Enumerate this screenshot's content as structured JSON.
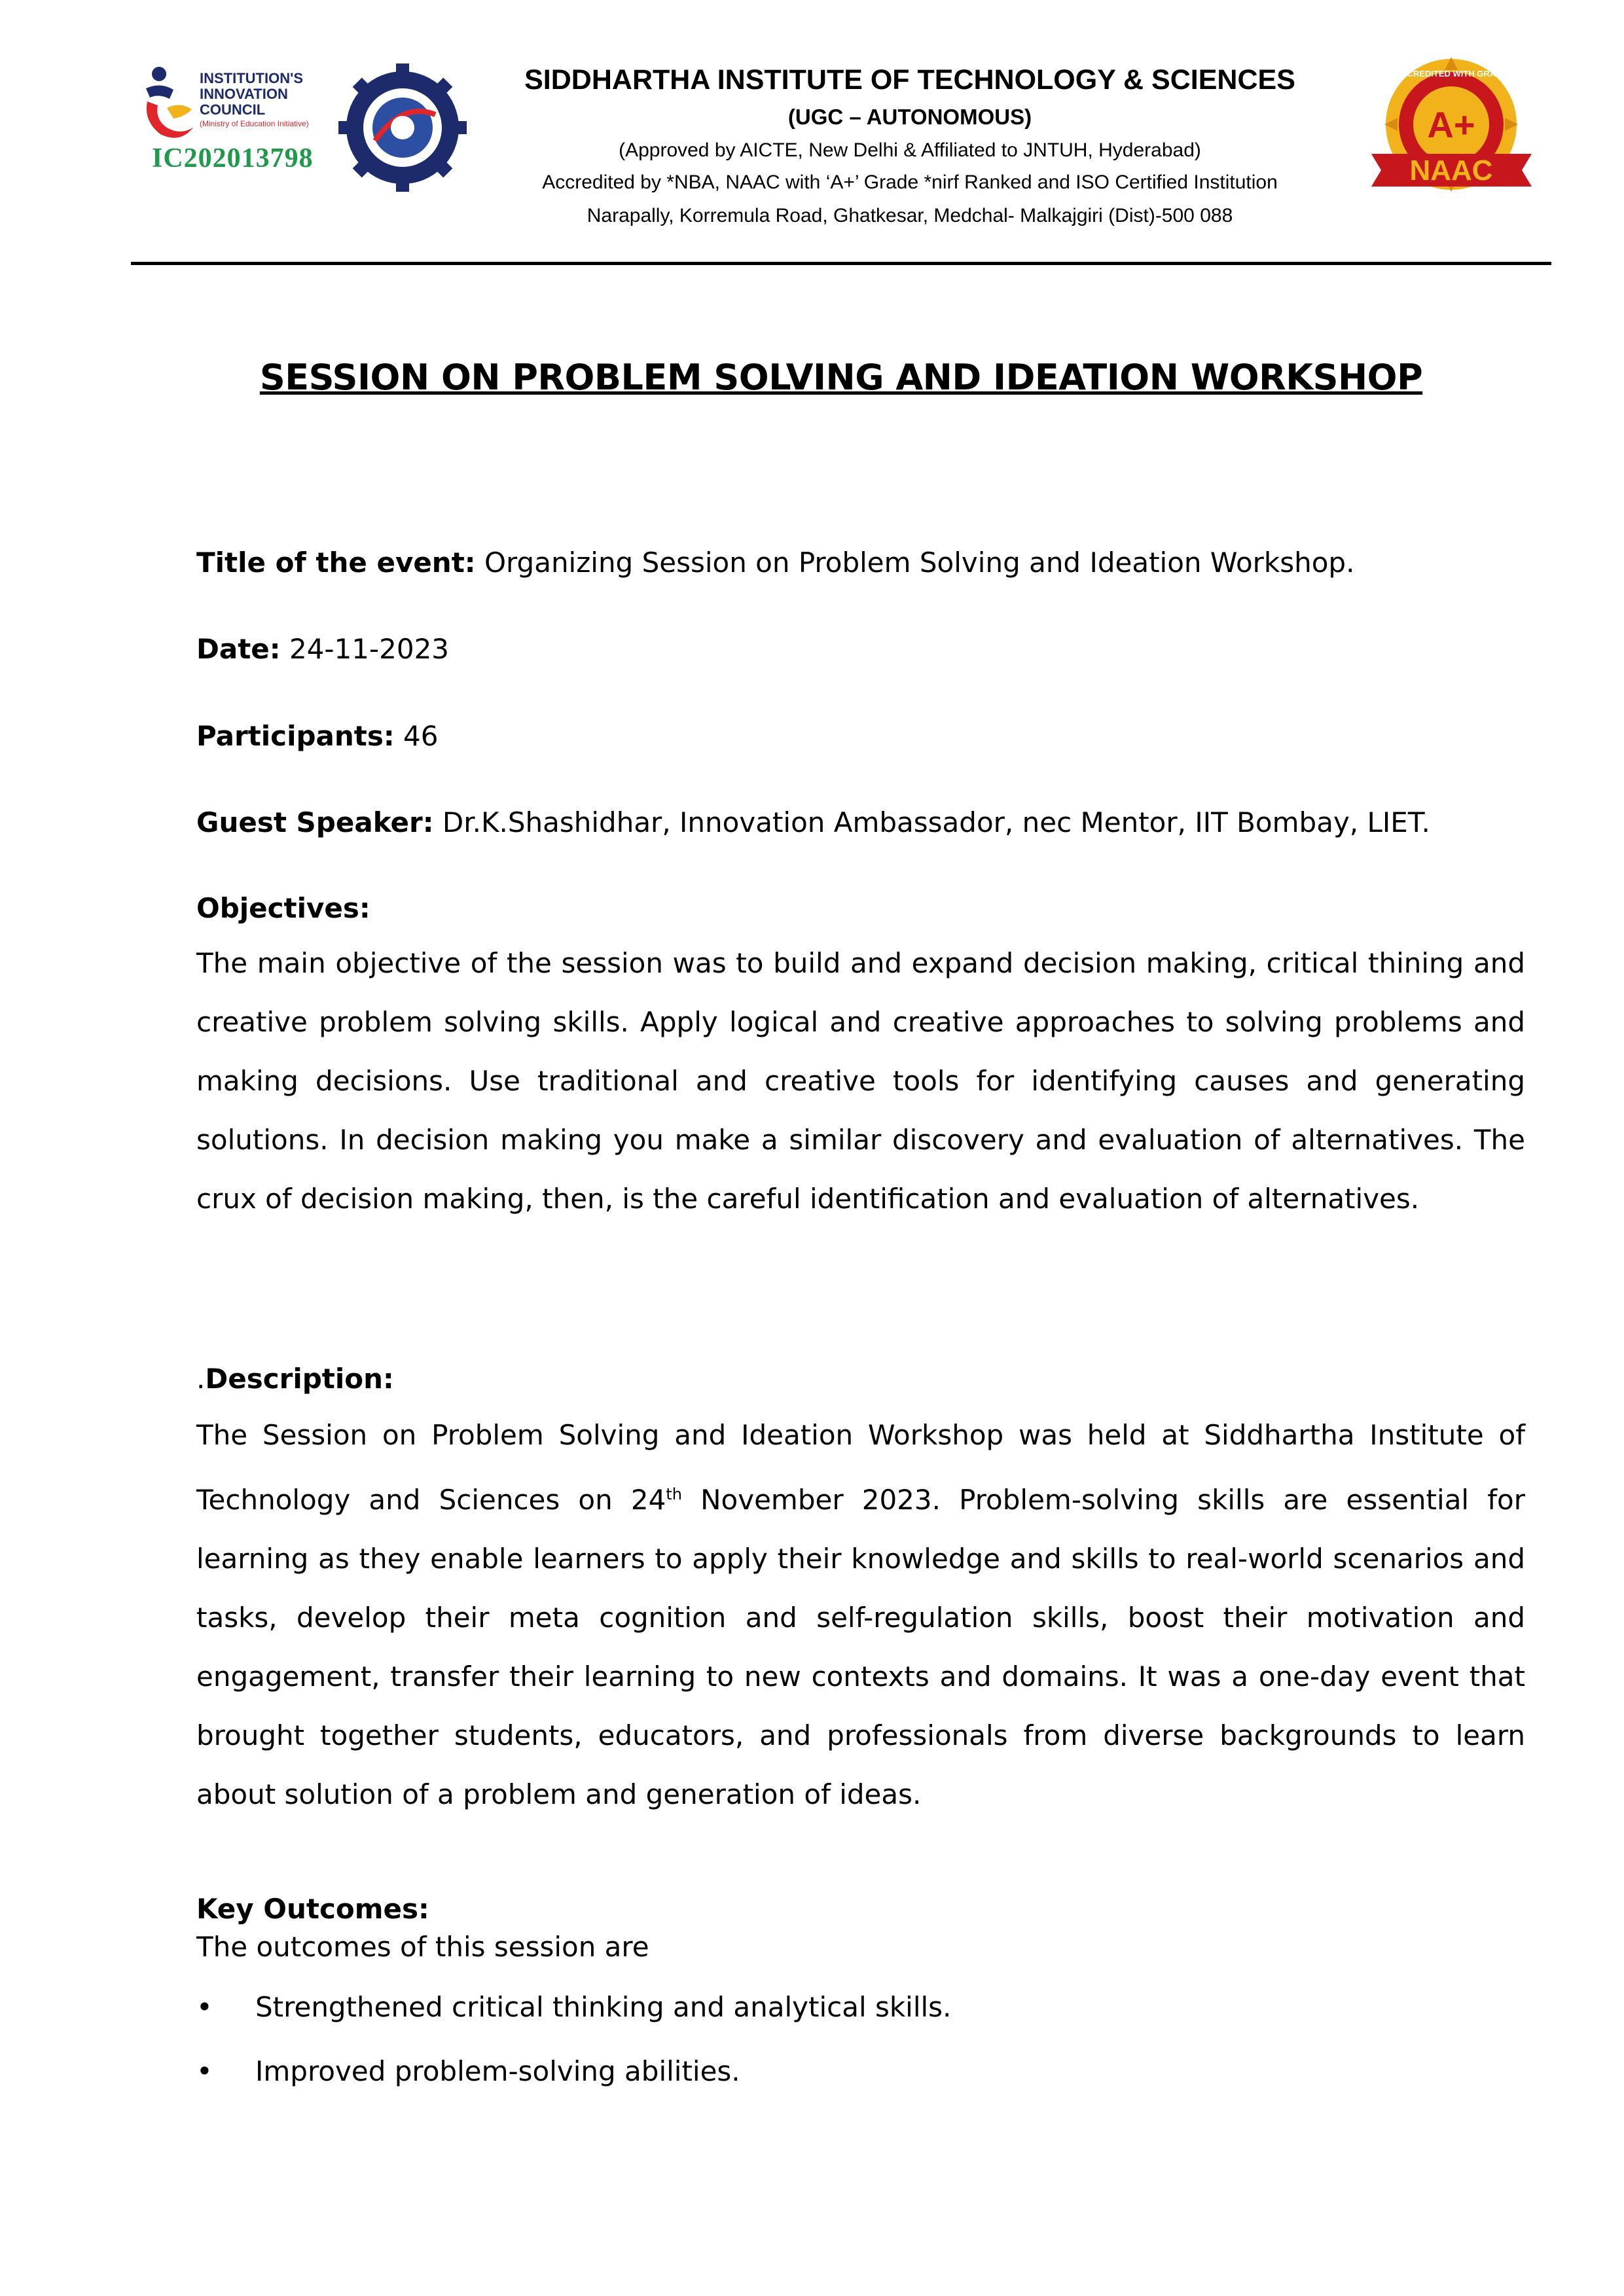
{
  "header": {
    "iic_logo_text": [
      "INSTITUTION'S",
      "INNOVATION",
      "COUNCIL",
      "(Ministry of Education Initiative)"
    ],
    "iic_id": "IC202013798",
    "institute_name": "SIDDHARTHA INSTITUTE OF TECHNOLOGY & SCIENCES",
    "ugc": "(UGC – AUTONOMOUS)",
    "approved": "(Approved by AICTE, New Delhi & Affiliated to JNTUH, Hyderabad)",
    "accredited": "Accredited by *NBA, NAAC with ‘A+’ Grade *nirf Ranked and ISO Certified Institution",
    "address": "Narapally, Korremula Road, Ghatkesar, Medchal- Malkajgiri (Dist)-500 088",
    "naac_badge": {
      "ring_text": "ACCREDITED WITH GRADE",
      "grade": "A+",
      "label": "NAAC"
    },
    "colors": {
      "iic_green": "#1e9a4a",
      "iic_blue": "#1d2a6b",
      "iic_red": "#e0262b",
      "naac_gold": "#f2b21b",
      "naac_red": "#c8161d"
    }
  },
  "title": "SESSION ON PROBLEM SOLVING AND IDEATION WORKSHOP",
  "fields": {
    "event_label": "Title of the event:",
    "event_value": "Organizing Session on Problem Solving and Ideation Workshop.",
    "date_label": "Date:",
    "date_value": "24-11-2023",
    "participants_label": "Participants:",
    "participants_value": "46",
    "speaker_label": "Guest Speaker:",
    "speaker_value": "Dr.K.Shashidhar, Innovation Ambassador, nec Mentor, IIT Bombay, LIET."
  },
  "objectives": {
    "heading": "Objectives:",
    "text": "The main objective of the session was to build and expand decision making, critical thining and creative problem solving skills. Apply logical and creative approaches to solving problems and making decisions. Use traditional and creative tools for identifying causes and generating solutions.  In decision making you make a similar discovery and evaluation of alternatives. The crux of decision making, then, is the careful identification and evaluation of alternatives."
  },
  "description": {
    "prefix": ".",
    "heading": "Description:",
    "text_before": "The Session on Problem Solving and Ideation Workshop was held at Siddhartha Institute of Technology and Sciences on 24",
    "superscript": "th",
    "text_after": " November 2023. Problem-solving skills are essential for learning as they enable learners to apply their knowledge and skills to real-world scenarios and tasks, develop their meta cognition and self-regulation skills, boost their motivation and engagement, transfer their learning to new contexts and domains. It was a one-day event that brought together students, educators, and professionals from diverse backgrounds to learn about solution of a problem and generation of ideas."
  },
  "key_outcomes": {
    "heading": "Key Outcomes:",
    "intro": "The outcomes of this session are",
    "bullet_symbol": "•",
    "items": [
      "Strengthened critical thinking and analytical skills.",
      "Improved problem-solving abilities."
    ]
  }
}
